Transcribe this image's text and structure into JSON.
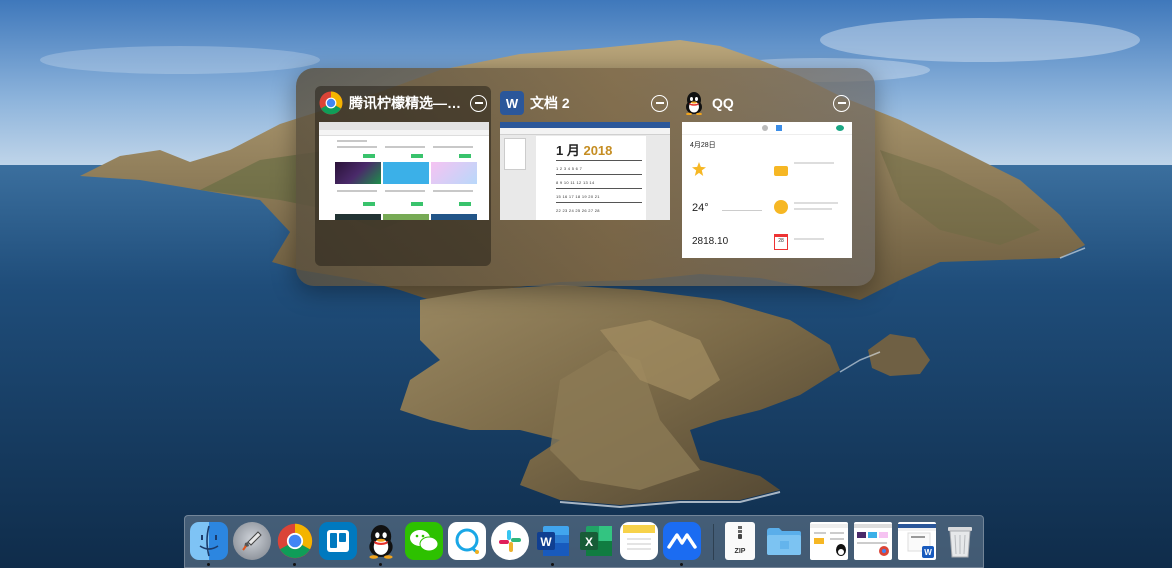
{
  "switcher": {
    "windows": [
      {
        "title": "腾讯柠檬精选——...",
        "app": "Google Chrome",
        "icon": "chrome-icon",
        "selected": true
      },
      {
        "title": "文档 2",
        "app": "Microsoft Word",
        "icon": "word-icon",
        "selected": false
      },
      {
        "title": "QQ",
        "app": "QQ",
        "icon": "qq-icon",
        "selected": false
      }
    ],
    "word_thumb": {
      "month": "1 月",
      "year": "2018",
      "rows": [
        "1 2 3 4 5 6 7",
        "8 9 10 11 12 13 14",
        "15 16 17 18 19 20 21",
        "22 23 24 25 26 27 28"
      ]
    },
    "qq_thumb": {
      "date": "4月28日",
      "temp": "24°",
      "number": "2818.10",
      "cal_day": "28"
    }
  },
  "dock": {
    "items": [
      {
        "name": "Finder",
        "icon": "finder-icon",
        "running": true
      },
      {
        "name": "Launchpad",
        "icon": "launchpad-icon",
        "running": false
      },
      {
        "name": "Google Chrome",
        "icon": "chrome-icon",
        "running": true
      },
      {
        "name": "Trello",
        "icon": "trello-icon",
        "running": false
      },
      {
        "name": "QQ",
        "icon": "qq-icon",
        "running": true
      },
      {
        "name": "WeChat",
        "icon": "wechat-icon",
        "running": false
      },
      {
        "name": "Tencent Meeting",
        "icon": "meeting-bubble-icon",
        "running": false
      },
      {
        "name": "Slack",
        "icon": "slack-icon",
        "running": false
      },
      {
        "name": "Microsoft Word",
        "icon": "word-icon",
        "running": true
      },
      {
        "name": "Microsoft Excel",
        "icon": "excel-icon",
        "running": false
      },
      {
        "name": "Notes",
        "icon": "notes-icon",
        "running": false
      },
      {
        "name": "Tencent Meeting",
        "icon": "tencent-meeting-icon",
        "running": true
      },
      {
        "name": "Archive",
        "icon": "zip-file-icon",
        "label": "ZIP",
        "running": false
      },
      {
        "name": "Folder",
        "icon": "folder-icon",
        "running": false
      },
      {
        "name": "QQ window",
        "icon": "minimized-qq-window-icon",
        "running": false
      },
      {
        "name": "Chrome window",
        "icon": "minimized-chrome-window-icon",
        "running": false
      },
      {
        "name": "Word window",
        "icon": "minimized-word-window-icon",
        "running": false
      },
      {
        "name": "Trash",
        "icon": "trash-icon",
        "running": false
      }
    ]
  },
  "colors": {
    "chrome_red": "#db4437",
    "chrome_green": "#0f9d58",
    "chrome_yellow": "#f4b400",
    "chrome_blue": "#4285f4",
    "word_blue": "#2b579a",
    "excel_green": "#1d6f42",
    "switcher_bg": "#6e5e44"
  }
}
